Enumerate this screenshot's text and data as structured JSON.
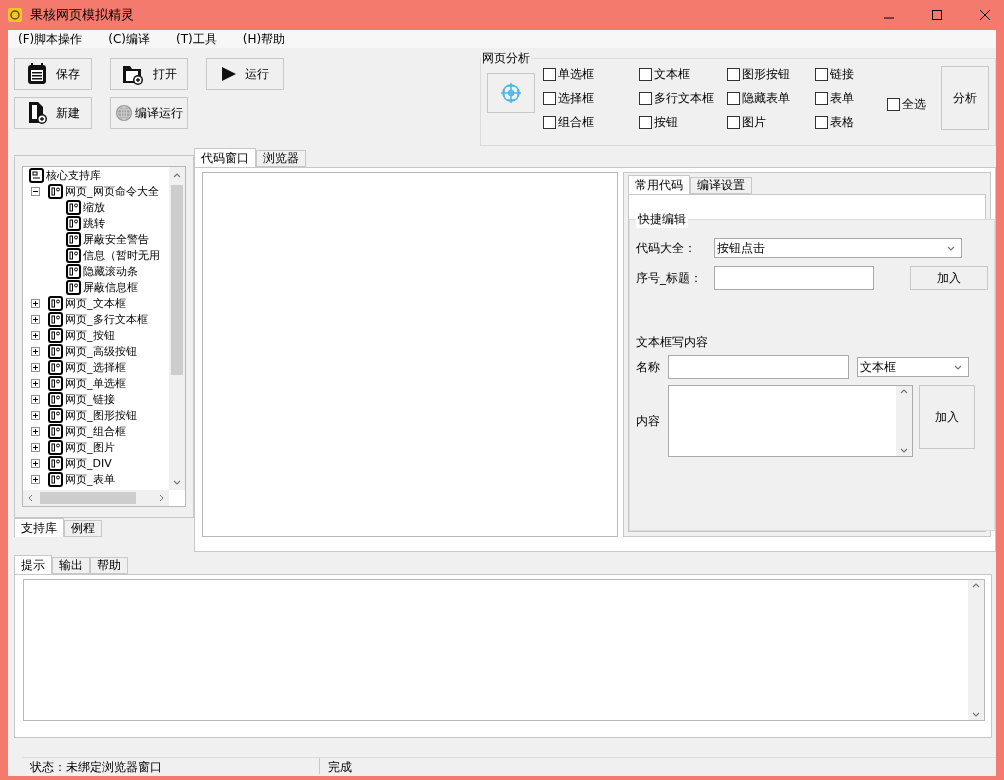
{
  "window": {
    "title": "果核网页模拟精灵"
  },
  "menu": [
    {
      "label": "(F)脚本操作"
    },
    {
      "label": "(C)编译"
    },
    {
      "label": "(T)工具"
    },
    {
      "label": "(H)帮助"
    }
  ],
  "toolbar": [
    {
      "label": "保存",
      "kind": "save"
    },
    {
      "label": "打开",
      "kind": "open"
    },
    {
      "label": "运行",
      "kind": "run"
    },
    {
      "label": "新建",
      "kind": "new"
    },
    {
      "label": "编译运行",
      "kind": "compile"
    }
  ],
  "analysis": {
    "title": "网页分析",
    "options": [
      {
        "label": "单选框",
        "checked": false
      },
      {
        "label": "选择框",
        "checked": false
      },
      {
        "label": "组合框",
        "checked": false
      },
      {
        "label": "文本框",
        "checked": false
      },
      {
        "label": "多行文本框",
        "checked": false
      },
      {
        "label": "按钮",
        "checked": false
      },
      {
        "label": "图形按钮",
        "checked": false
      },
      {
        "label": "隐藏表单",
        "checked": false
      },
      {
        "label": "图片",
        "checked": false
      },
      {
        "label": "链接",
        "checked": false
      },
      {
        "label": "表单",
        "checked": false
      },
      {
        "label": "表格",
        "checked": false
      }
    ],
    "select_all": {
      "label": "全选",
      "checked": false
    },
    "analyze_button": "分析"
  },
  "library_tree": {
    "label": "核心支持库",
    "children": [
      {
        "label": "网页_网页命令大全",
        "expanded": true,
        "children": [
          {
            "label": "缩放"
          },
          {
            "label": "跳转"
          },
          {
            "label": "屏蔽安全警告"
          },
          {
            "label": "信息（暂时无用"
          },
          {
            "label": "隐藏滚动条"
          },
          {
            "label": "屏蔽信息框"
          }
        ]
      },
      {
        "label": "网页_文本框",
        "expanded": false
      },
      {
        "label": "网页_多行文本框",
        "expanded": false
      },
      {
        "label": "网页_按钮",
        "expanded": false
      },
      {
        "label": "网页_高级按钮",
        "expanded": false
      },
      {
        "label": "网页_选择框",
        "expanded": false
      },
      {
        "label": "网页_单选框",
        "expanded": false
      },
      {
        "label": "网页_链接",
        "expanded": false
      },
      {
        "label": "网页_图形按钮",
        "expanded": false
      },
      {
        "label": "网页_组合框",
        "expanded": false
      },
      {
        "label": "网页_图片",
        "expanded": false
      },
      {
        "label": "网页_DIV",
        "expanded": false
      },
      {
        "label": "网页_表单",
        "expanded": false
      }
    ]
  },
  "library_tabs": [
    {
      "label": "支持库",
      "selected": true
    },
    {
      "label": "例程",
      "selected": false
    }
  ],
  "editor_tabs": [
    {
      "label": "代码窗口",
      "selected": true
    },
    {
      "label": "浏览器",
      "selected": false
    }
  ],
  "side_tabs": [
    {
      "label": "常用代码",
      "selected": true
    },
    {
      "label": "编译设置",
      "selected": false
    }
  ],
  "quick_edit": {
    "title": "快捷编辑",
    "code_label": "代码大全：",
    "code_value": "按钮点击",
    "index_label": "序号_标题：",
    "add_button": "加入",
    "textbox_title": "文本框写内容",
    "name_label": "名称",
    "type_value": "文本框",
    "content_label": "内容",
    "content_add_button": "加入"
  },
  "output_tabs": [
    {
      "label": "提示",
      "selected": true
    },
    {
      "label": "输出",
      "selected": false
    },
    {
      "label": "帮助",
      "selected": false
    }
  ],
  "status_bar": [
    "状态：未绑定浏览器窗口",
    "完成"
  ]
}
